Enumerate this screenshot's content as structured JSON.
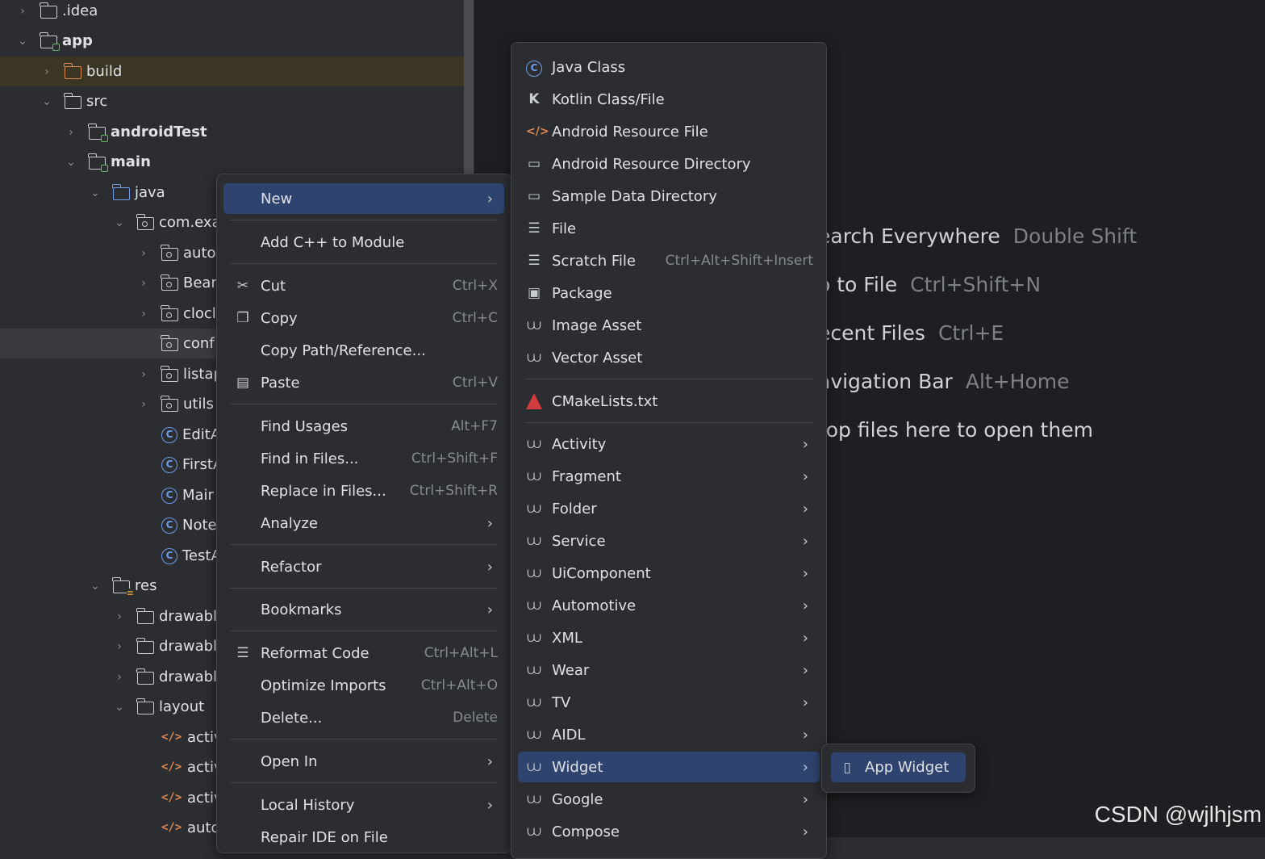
{
  "project_tree": {
    "items": [
      {
        "label": ".idea",
        "depth": 0,
        "chevron": ">",
        "icon": "folder-icon",
        "bold": false
      },
      {
        "label": "app",
        "depth": 0,
        "chevron": "v",
        "icon": "module-folder-icon",
        "bold": true
      },
      {
        "label": "build",
        "depth": 1,
        "chevron": ">",
        "icon": "excluded-folder-icon",
        "bold": false
      },
      {
        "label": "src",
        "depth": 1,
        "chevron": "v",
        "icon": "folder-icon",
        "bold": false
      },
      {
        "label": "androidTest",
        "depth": 2,
        "chevron": ">",
        "icon": "module-folder-icon",
        "bold": true
      },
      {
        "label": "main",
        "depth": 2,
        "chevron": "v",
        "icon": "module-folder-icon",
        "bold": true
      },
      {
        "label": "java",
        "depth": 3,
        "chevron": "v",
        "icon": "source-folder-icon",
        "bold": false
      },
      {
        "label": "com.exa",
        "depth": 4,
        "chevron": "v",
        "icon": "package-icon",
        "bold": false
      },
      {
        "label": "auto",
        "depth": 5,
        "chevron": ">",
        "icon": "package-icon",
        "bold": false
      },
      {
        "label": "Bear",
        "depth": 5,
        "chevron": ">",
        "icon": "package-icon",
        "bold": false
      },
      {
        "label": "clocl",
        "depth": 5,
        "chevron": ">",
        "icon": "package-icon",
        "bold": false
      },
      {
        "label": "conf",
        "depth": 5,
        "chevron": "",
        "icon": "package-icon",
        "bold": false
      },
      {
        "label": "listap",
        "depth": 5,
        "chevron": ">",
        "icon": "package-icon",
        "bold": false
      },
      {
        "label": "utils",
        "depth": 5,
        "chevron": ">",
        "icon": "package-icon",
        "bold": false
      },
      {
        "label": "EditA",
        "depth": 5,
        "chevron": "",
        "icon": "class-icon",
        "bold": false
      },
      {
        "label": "FirstA",
        "depth": 5,
        "chevron": "",
        "icon": "class-icon",
        "bold": false
      },
      {
        "label": "Mair",
        "depth": 5,
        "chevron": "",
        "icon": "class-icon",
        "bold": false
      },
      {
        "label": "Note",
        "depth": 5,
        "chevron": "",
        "icon": "class-icon",
        "bold": false
      },
      {
        "label": "TestA",
        "depth": 5,
        "chevron": "",
        "icon": "class-icon",
        "bold": false
      },
      {
        "label": "res",
        "depth": 3,
        "chevron": "v",
        "icon": "resource-folder-icon",
        "bold": false
      },
      {
        "label": "drawable",
        "depth": 4,
        "chevron": ">",
        "icon": "folder-icon",
        "bold": false
      },
      {
        "label": "drawable",
        "depth": 4,
        "chevron": ">",
        "icon": "folder-icon",
        "bold": false
      },
      {
        "label": "drawable",
        "depth": 4,
        "chevron": ">",
        "icon": "folder-icon",
        "bold": false
      },
      {
        "label": "layout",
        "depth": 4,
        "chevron": "v",
        "icon": "folder-icon",
        "bold": false
      },
      {
        "label": "activ",
        "depth": 5,
        "chevron": "",
        "icon": "xml-file-icon",
        "bold": false
      },
      {
        "label": "activ",
        "depth": 5,
        "chevron": "",
        "icon": "xml-file-icon",
        "bold": false
      },
      {
        "label": "activ",
        "depth": 5,
        "chevron": "",
        "icon": "xml-file-icon",
        "bold": false
      },
      {
        "label": "auto",
        "depth": 5,
        "chevron": "",
        "icon": "xml-file-icon",
        "bold": false
      }
    ]
  },
  "editor_hints": [
    {
      "label": "earch Everywhere",
      "shortcut": "Double Shift"
    },
    {
      "label": "o to File",
      "shortcut": "Ctrl+Shift+N"
    },
    {
      "label": "ecent Files",
      "shortcut": "Ctrl+E"
    },
    {
      "label": "avigation Bar",
      "shortcut": "Alt+Home"
    },
    {
      "label": "rop files here to open them",
      "shortcut": ""
    }
  ],
  "context_menu": {
    "new": {
      "label": "New"
    },
    "add_cpp": {
      "label": "Add C++ to Module"
    },
    "cut": {
      "label": "Cut",
      "shortcut": "Ctrl+X"
    },
    "copy": {
      "label": "Copy",
      "shortcut": "Ctrl+C"
    },
    "copy_path": {
      "label": "Copy Path/Reference..."
    },
    "paste": {
      "label": "Paste",
      "shortcut": "Ctrl+V"
    },
    "find_usages": {
      "label": "Find Usages",
      "shortcut": "Alt+F7"
    },
    "find_in_files": {
      "label": "Find in Files...",
      "shortcut": "Ctrl+Shift+F"
    },
    "replace_in_files": {
      "label": "Replace in Files...",
      "shortcut": "Ctrl+Shift+R"
    },
    "analyze": {
      "label": "Analyze"
    },
    "refactor": {
      "label": "Refactor"
    },
    "bookmarks": {
      "label": "Bookmarks"
    },
    "reformat": {
      "label": "Reformat Code",
      "shortcut": "Ctrl+Alt+L"
    },
    "optimize": {
      "label": "Optimize Imports",
      "shortcut": "Ctrl+Alt+O"
    },
    "delete": {
      "label": "Delete...",
      "shortcut": "Delete"
    },
    "open_in": {
      "label": "Open In"
    },
    "local_history": {
      "label": "Local History"
    },
    "repair": {
      "label": "Repair IDE on File"
    }
  },
  "new_submenu": {
    "java_class": "Java Class",
    "kotlin_class": "Kotlin Class/File",
    "android_resource_file": "Android Resource File",
    "android_resource_directory": "Android Resource Directory",
    "sample_data_directory": "Sample Data Directory",
    "file": "File",
    "scratch_file": "Scratch File",
    "scratch_shortcut": "Ctrl+Alt+Shift+Insert",
    "package": "Package",
    "image_asset": "Image Asset",
    "vector_asset": "Vector Asset",
    "cmakelists": "CMakeLists.txt",
    "activity": "Activity",
    "fragment": "Fragment",
    "folder": "Folder",
    "service": "Service",
    "uicomponent": "UiComponent",
    "automotive": "Automotive",
    "xml": "XML",
    "wear": "Wear",
    "tv": "TV",
    "aidl": "AIDL",
    "widget": "Widget",
    "google": "Google",
    "compose": "Compose"
  },
  "widget_submenu": {
    "app_widget": "App Widget"
  },
  "watermark": "CSDN @wjlhjsm",
  "colors": {
    "selection": "#2e436e",
    "accent_android": "#5fb85f",
    "accent_blue": "#6e9ce8"
  }
}
